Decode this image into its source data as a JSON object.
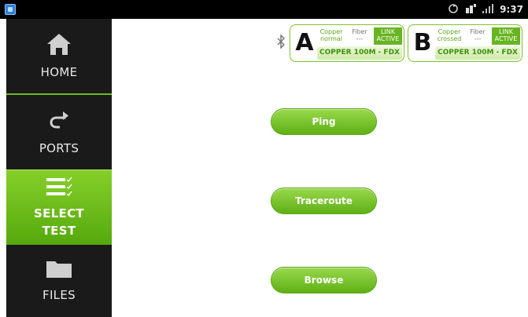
{
  "status_bar": {
    "time": "9:37",
    "icons": [
      "app-badge-icon",
      "sync-icon",
      "data-transfer-icon",
      "signal-bars-icon"
    ]
  },
  "sidebar": {
    "items": [
      {
        "label": "HOME",
        "icon": "home-icon"
      },
      {
        "label": "PORTS",
        "icon": "ports-icon"
      },
      {
        "label": "SELECT\nTEST",
        "line1": "SELECT",
        "line2": "TEST",
        "icon": "checklist-icon",
        "selected": true
      },
      {
        "label": "FILES",
        "icon": "folder-icon"
      }
    ]
  },
  "ports": {
    "a": {
      "letter": "A",
      "copper": "Copper\nnormal",
      "copper_l1": "Copper",
      "copper_l2": "normal",
      "fiber_l1": "Fiber",
      "fiber_l2": "---",
      "link_l1": "LINK",
      "link_l2": "ACTIVE",
      "speed": "COPPER 100M  - FDX"
    },
    "b": {
      "letter": "B",
      "copper_l1": "Copper",
      "copper_l2": "crossed",
      "fiber_l1": "Fiber",
      "fiber_l2": "---",
      "link_l1": "LINK",
      "link_l2": "ACTIVE",
      "speed": "COPPER 100M  - FDX"
    }
  },
  "tests": {
    "ping": "Ping",
    "traceroute": "Traceroute",
    "browse": "Browse"
  },
  "colors": {
    "accent_green": "#6dbb1e",
    "sidebar_bg": "#1a1a1a",
    "status_bar_bg": "#000000"
  }
}
